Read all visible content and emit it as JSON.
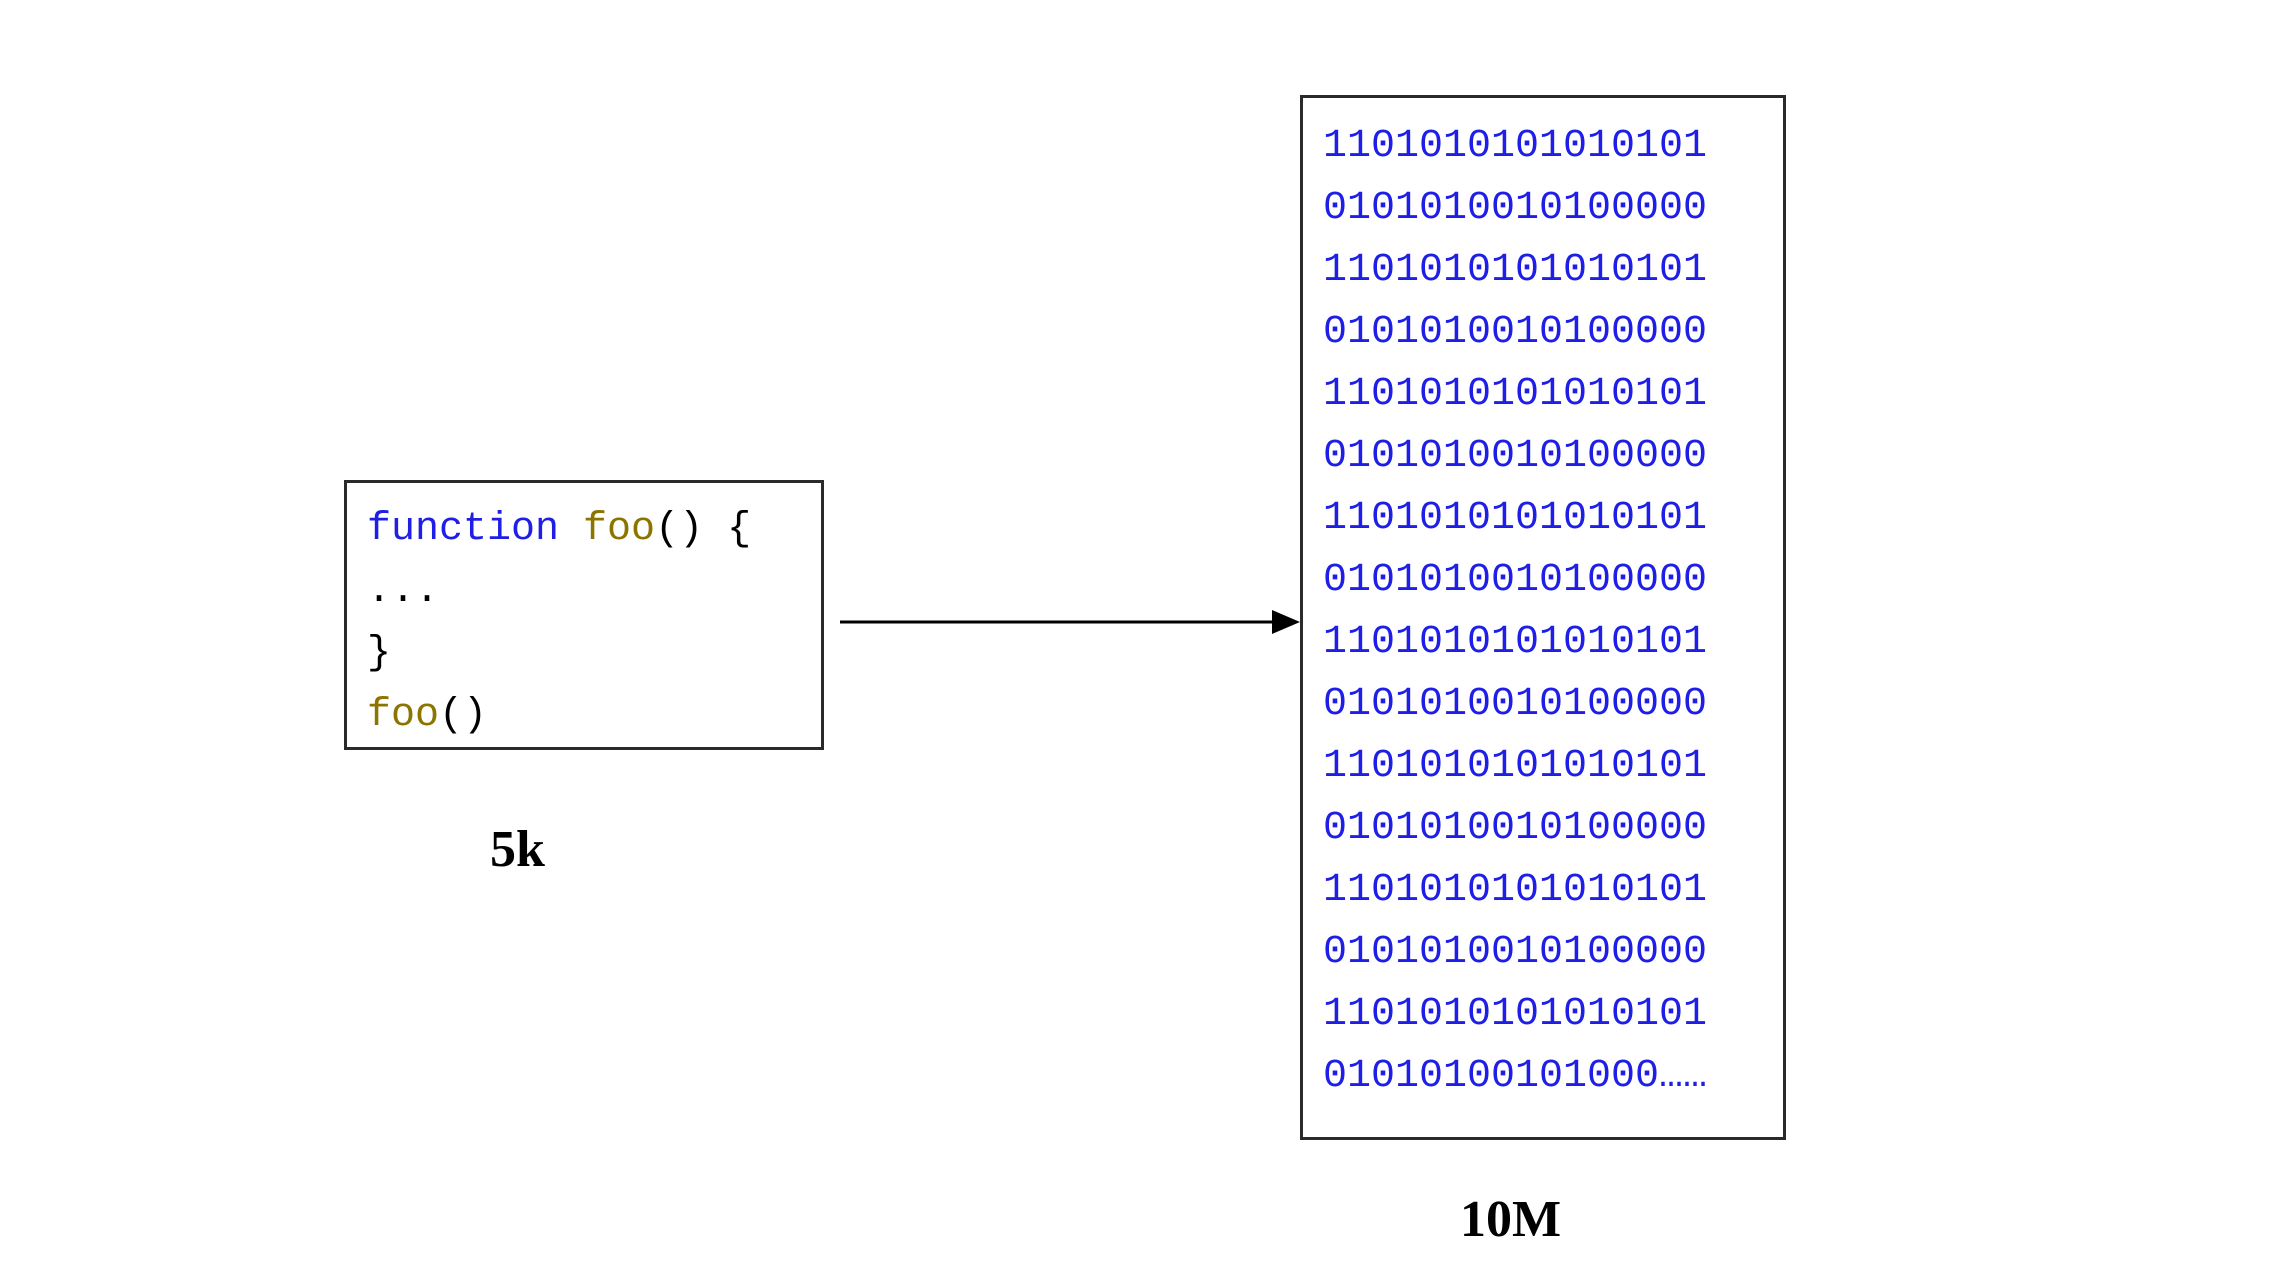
{
  "source": {
    "keyword": "function",
    "function_name": "foo",
    "paren_open_brace": "() {",
    "body_line": "...",
    "close_brace": "}",
    "call_name": "foo",
    "call_parens": "()"
  },
  "target": {
    "lines": [
      "1101010101010101",
      "0101010010100000",
      "1101010101010101",
      "0101010010100000",
      "1101010101010101",
      "0101010010100000",
      "1101010101010101",
      "0101010010100000",
      "1101010101010101",
      "0101010010100000",
      "1101010101010101",
      "0101010010100000",
      "1101010101010101",
      "0101010010100000",
      "1101010101010101",
      "01010100101000……"
    ]
  },
  "labels": {
    "source_size": "5k",
    "target_size": "10M"
  }
}
